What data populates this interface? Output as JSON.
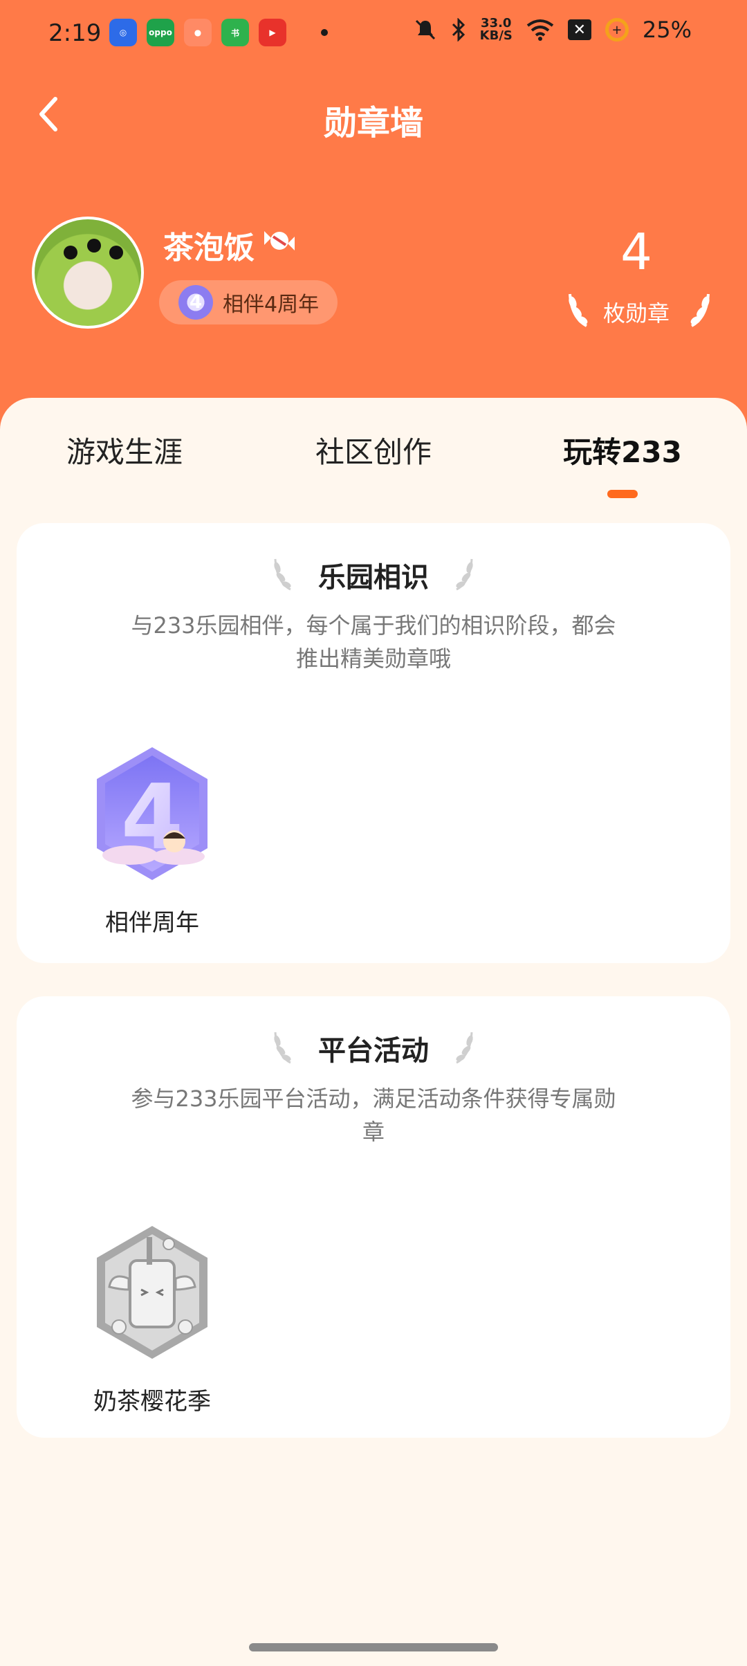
{
  "status_bar": {
    "time": "2:19",
    "net_speed_value": "33.0",
    "net_speed_unit": "KB/S",
    "battery": "25%"
  },
  "nav": {
    "title": "勋章墙"
  },
  "profile": {
    "username": "茶泡饭",
    "companion_label": "相伴4周年",
    "medal_count": "4",
    "medal_count_label": "枚勋章"
  },
  "tabs": [
    {
      "label": "游戏生涯",
      "active": false
    },
    {
      "label": "社区创作",
      "active": false
    },
    {
      "label": "玩转233",
      "active": true
    }
  ],
  "sections": [
    {
      "title": "乐园相识",
      "desc_line1": "与233乐园相伴，每个属于我们的相识阶段，都会",
      "desc_line2": "推出精美勋章哦",
      "medals": [
        {
          "name": "相伴周年",
          "icon": "anniversary-4-medal-icon",
          "number": "4",
          "unlocked": true
        }
      ]
    },
    {
      "title": "平台活动",
      "desc_line1": "参与233乐园平台活动，满足活动条件获得专属勋",
      "desc_line2": "章",
      "medals": [
        {
          "name": "奶茶樱花季",
          "icon": "milk-tea-sakura-medal-icon",
          "unlocked": false
        }
      ]
    }
  ],
  "colors": {
    "header": "#ff7a48",
    "background": "#fff7ee",
    "accent": "#ff6a1e"
  }
}
